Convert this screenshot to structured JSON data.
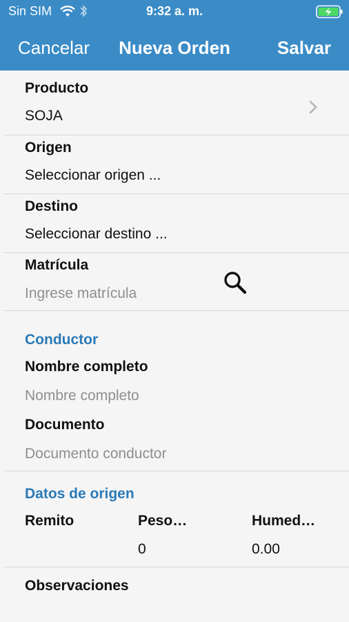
{
  "status": {
    "carrier": "Sin SIM",
    "time": "9:32 a. m."
  },
  "nav": {
    "cancel": "Cancelar",
    "title": "Nueva Orden",
    "save": "Salvar"
  },
  "producto": {
    "label": "Producto",
    "value": "SOJA"
  },
  "origen": {
    "label": "Origen",
    "value": "Seleccionar origen ..."
  },
  "destino": {
    "label": "Destino",
    "value": "Seleccionar destino ..."
  },
  "matricula": {
    "label": "Matrícula",
    "placeholder": "Ingrese matrícula"
  },
  "conductor": {
    "section": "Conductor",
    "nombre_label": "Nombre completo",
    "nombre_placeholder": "Nombre completo",
    "documento_label": "Documento",
    "documento_placeholder": "Documento conductor"
  },
  "datos_origen": {
    "section": "Datos de origen",
    "columns": [
      "Remito",
      "Peso…",
      "Humed…"
    ],
    "values": [
      "",
      "0",
      "0.00"
    ]
  },
  "observaciones": {
    "label": "Observaciones"
  },
  "colors": {
    "nav_bar": "#3a8bc6",
    "section_text": "#2a7ab8",
    "battery": "#4cd964"
  }
}
